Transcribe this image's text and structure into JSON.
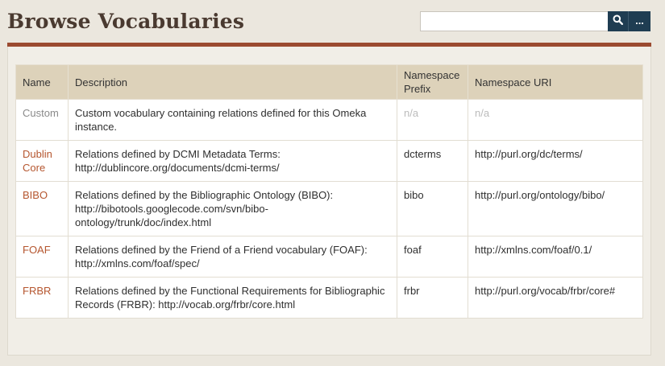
{
  "page": {
    "title": "Browse Vocabularies"
  },
  "search": {
    "placeholder": "",
    "value": "",
    "more_label": "..."
  },
  "table": {
    "headers": {
      "name": "Name",
      "description": "Description",
      "prefix": "Namespace Prefix",
      "uri": "Namespace URI"
    },
    "rows": [
      {
        "name": "Custom",
        "description": "Custom vocabulary containing relations defined for this Omeka instance.",
        "prefix": "n/a",
        "uri": "n/a"
      },
      {
        "name": "Dublin Core",
        "description": "Relations defined by DCMI Metadata Terms: http://dublincore.org/documents/dcmi-terms/",
        "prefix": "dcterms",
        "uri": "http://purl.org/dc/terms/"
      },
      {
        "name": "BIBO",
        "description": "Relations defined by the Bibliographic Ontology (BIBO): http://bibotools.googlecode.com/svn/bibo-ontology/trunk/doc/index.html",
        "prefix": "bibo",
        "uri": "http://purl.org/ontology/bibo/"
      },
      {
        "name": "FOAF",
        "description": "Relations defined by the Friend of a Friend vocabulary (FOAF): http://xmlns.com/foaf/spec/",
        "prefix": "foaf",
        "uri": "http://xmlns.com/foaf/0.1/"
      },
      {
        "name": "FRBR",
        "description": "Relations defined by the Functional Requirements for Bibliographic Records (FRBR): http://vocab.org/frbr/core.html",
        "prefix": "frbr",
        "uri": "http://purl.org/vocab/frbr/core#"
      }
    ]
  },
  "colors": {
    "accent": "#9b4a30",
    "link": "#b5562f",
    "button": "#1f3d52",
    "header_bg": "#ddd2ba",
    "page_bg": "#ebe7de"
  },
  "icons": {
    "search": "search-icon"
  }
}
